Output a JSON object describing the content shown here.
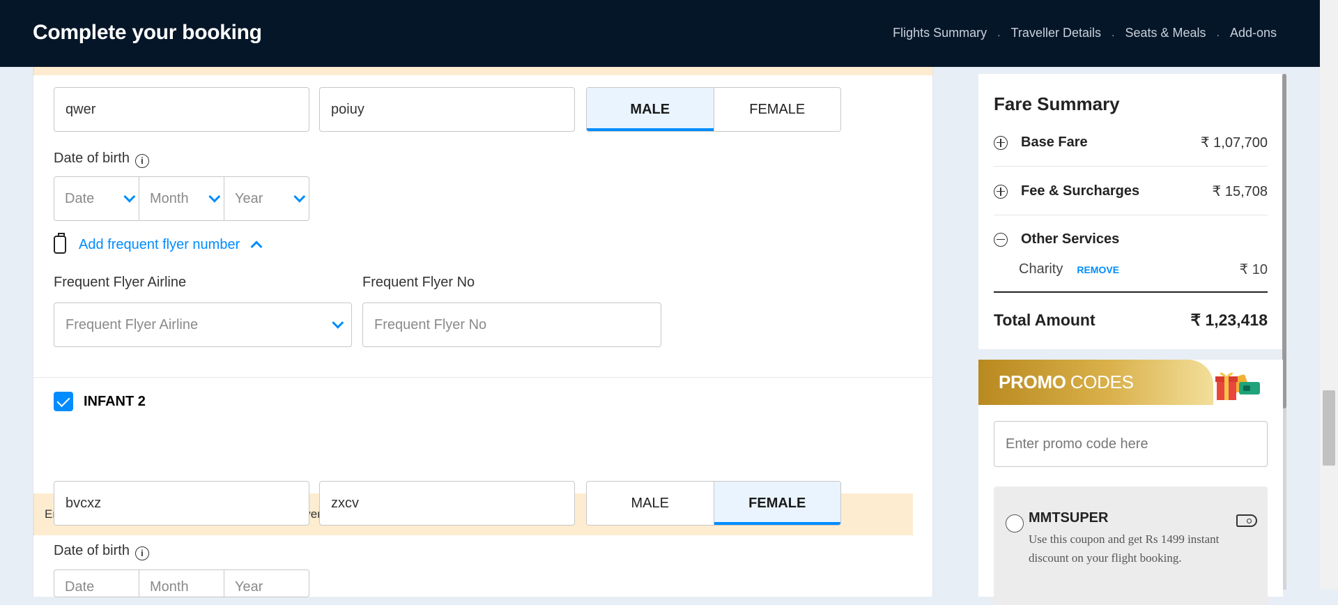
{
  "header": {
    "title": "Complete your booking",
    "steps": [
      "Flights Summary",
      "Traveller Details",
      "Seats & Meals",
      "Add-ons"
    ],
    "separator": "."
  },
  "traveller_1": {
    "first_name": "qwer",
    "last_name": "poiuy",
    "gender_options": [
      "MALE",
      "FEMALE"
    ],
    "gender_selected": "MALE",
    "dob_label": "Date of birth",
    "dob_date": "Date",
    "dob_month": "Month",
    "dob_year": "Year",
    "ff_link": "Add frequent flyer number",
    "ff_airline_label": "Frequent Flyer Airline",
    "ff_airline_placeholder": "Frequent Flyer Airline",
    "ff_no_label": "Frequent Flyer No",
    "ff_no_placeholder": "Frequent Flyer No"
  },
  "traveller_2": {
    "section_title": "INFANT 2",
    "checked": true,
    "notice": "Enter name as mentioned on your passport or Government approved IDs.",
    "first_name": "bvcxz",
    "last_name": "zxcv",
    "gender_options": [
      "MALE",
      "FEMALE"
    ],
    "gender_selected": "FEMALE",
    "dob_label": "Date of birth",
    "dob_date": "Date",
    "dob_month": "Month",
    "dob_year": "Year"
  },
  "fare_summary": {
    "title": "Fare Summary",
    "base_fare_label": "Base Fare",
    "base_fare_value": "₹ 1,07,700",
    "fees_label": "Fee & Surcharges",
    "fees_value": "₹ 15,708",
    "other_label": "Other Services",
    "charity_label": "Charity",
    "charity_remove": "REMOVE",
    "charity_value": "₹ 10",
    "total_label": "Total Amount",
    "total_value": "₹ 1,23,418"
  },
  "promo": {
    "title_bold": "PROMO",
    "title_rest": "CODES",
    "input_placeholder": "Enter promo code here",
    "coupon_code": "MMTSUPER",
    "coupon_desc": "Use this coupon and get Rs 1499 instant discount on your flight booking."
  },
  "colors": {
    "header_bg": "#061629",
    "accent": "#008cff",
    "notice_bg": "#fdeccf",
    "page_bg": "#e8eef5"
  }
}
